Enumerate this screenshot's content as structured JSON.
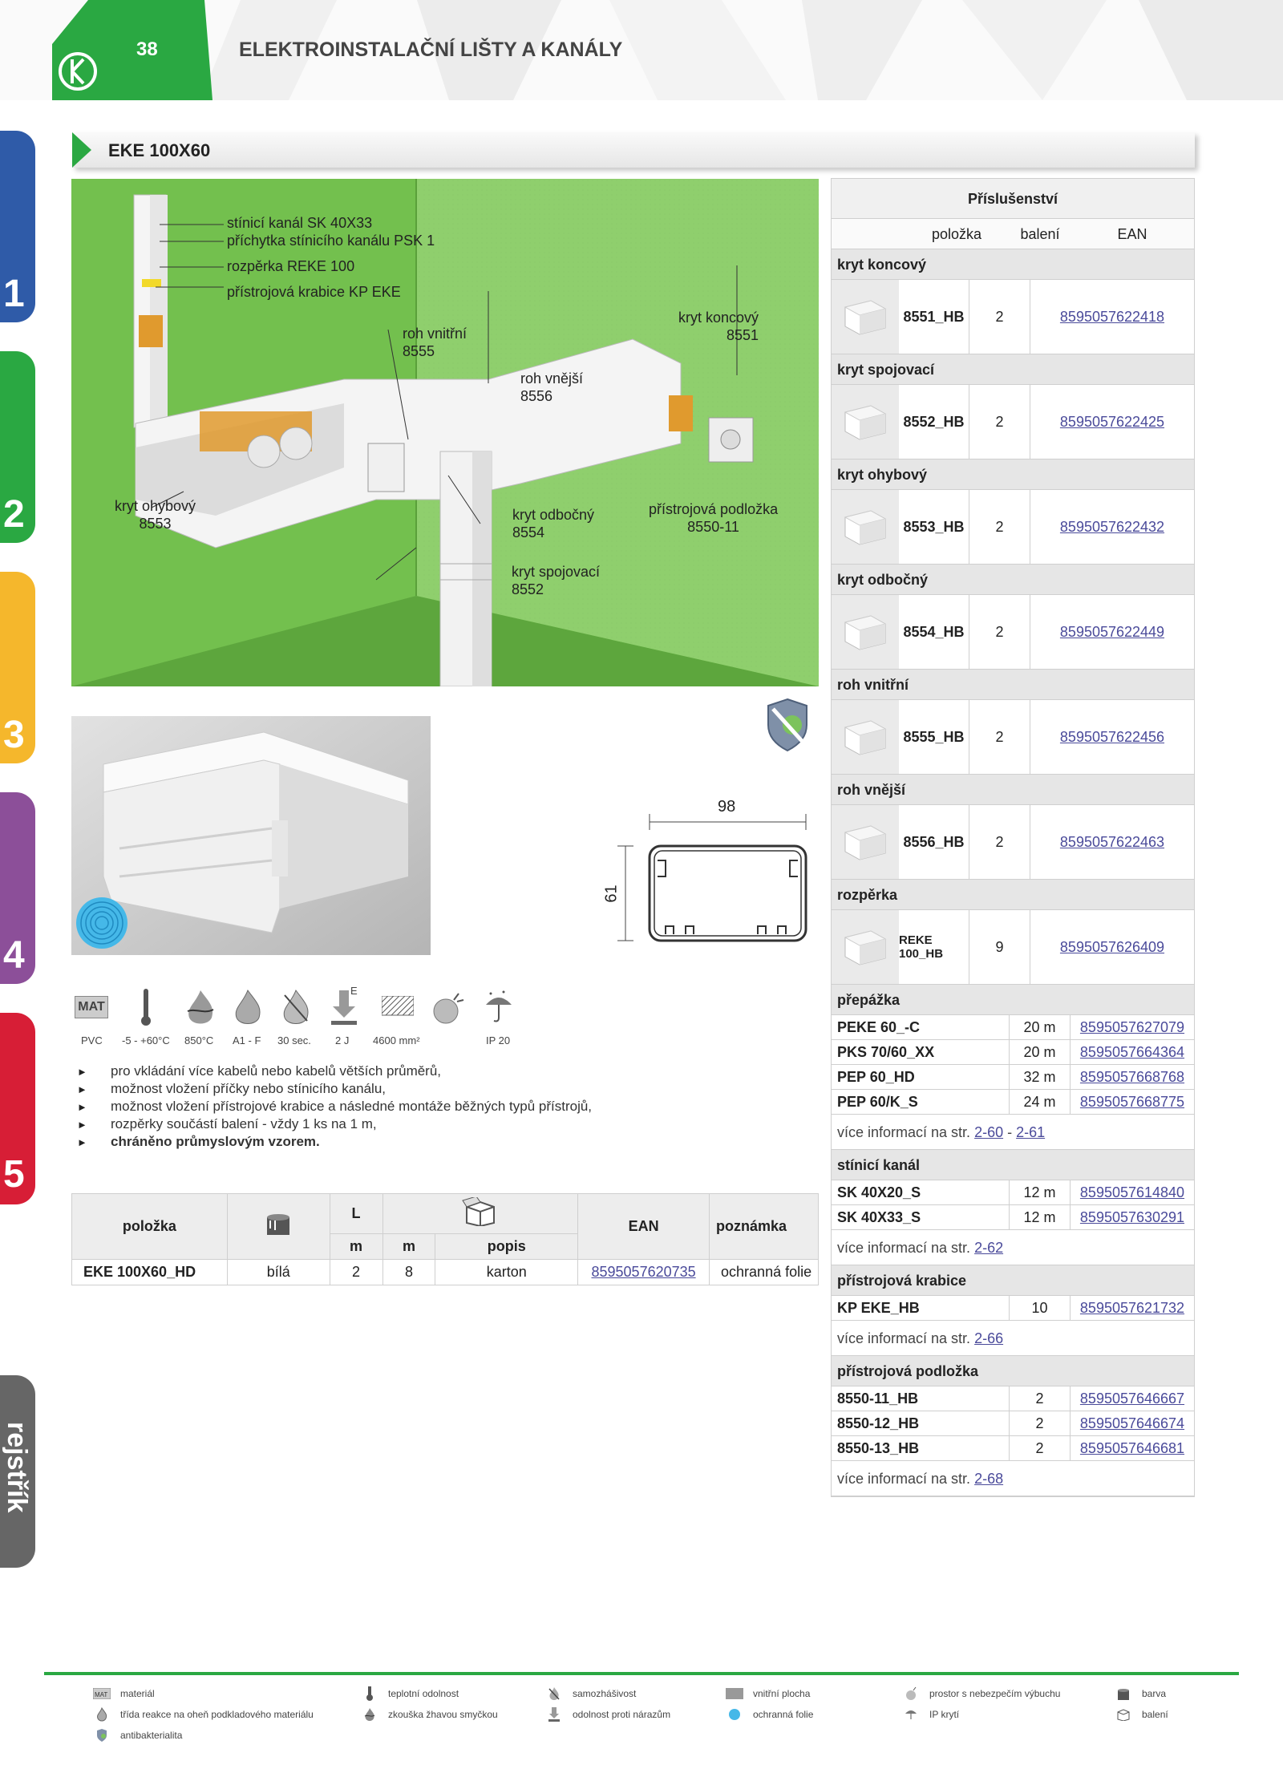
{
  "header": {
    "page_number": "38",
    "title": "ELEKTROINSTALAČNÍ LIŠTY A KANÁLY"
  },
  "colors": {
    "green": "#2aa842",
    "tab1": "#2f5ba8",
    "tab2": "#2aa842",
    "tab3": "#f5b72c",
    "tab4": "#8c4f99",
    "tab5": "#d71e36",
    "index": "#666666",
    "ean_link": "#4a4a9a"
  },
  "tabs": [
    "1",
    "2",
    "3",
    "4",
    "5",
    "rejstřík"
  ],
  "product": {
    "title": "EKE 100X60"
  },
  "scene_callouts": [
    "stínicí kanál SK 40X33",
    "příchytka stínicího kanálu PSK 1",
    "rozpěrka REKE 100",
    "přístrojová krabice KP EKE",
    "roh vnitřní\n8555",
    "roh vnější\n8556",
    "kryt koncový\n8551",
    "kryt ohybový\n8553",
    "kryt odbočný\n8554",
    "přístrojová podložka\n8550-11",
    "kryt spojovací\n8552"
  ],
  "dimensions": {
    "width": "98",
    "height": "61"
  },
  "pictograms": [
    {
      "icon": "mat-icon",
      "label": "PVC"
    },
    {
      "icon": "thermometer-icon",
      "label": "-5 - +60°C"
    },
    {
      "icon": "glow-wire-icon",
      "label": "850°C"
    },
    {
      "icon": "flame-icon",
      "label": "A1 - F"
    },
    {
      "icon": "self-extinguish-icon",
      "label": "30 sec."
    },
    {
      "icon": "impact-icon",
      "label": "2 J"
    },
    {
      "icon": "inner-area-icon",
      "label": "4600 mm²"
    },
    {
      "icon": "explosion-icon",
      "label": ""
    },
    {
      "icon": "ip-umbrella-icon",
      "label": "IP 20"
    }
  ],
  "impact_mark": "E",
  "features": [
    "pro vkládání více kabelů nebo kabelů větších průměrů,",
    "možnost vložení příčky nebo stínicího kanálu,",
    "možnost vložení přístrojové krabice a následné montáže běžných typů přístrojů,",
    "rozpěrky součástí balení - vždy 1 ks na 1 m,",
    "chráněno průmyslovým vzorem."
  ],
  "product_table": {
    "headers": {
      "item": "položka",
      "L": "L",
      "ean": "EAN",
      "note": "poznámka",
      "L_unit": "m",
      "pack_unit": "m",
      "pack_desc": "popis"
    },
    "rows": [
      {
        "item": "EKE 100X60_HD",
        "color": "bílá",
        "length": "2",
        "pack": "8",
        "desc": "karton",
        "ean": "8595057620735",
        "note": "ochranná folie"
      }
    ]
  },
  "accessories": {
    "title": "Příslušenství",
    "columns": [
      "položka",
      "balení",
      "EAN"
    ],
    "image_groups": [
      {
        "name": "kryt koncový",
        "code": "8551_HB",
        "pack": "2",
        "ean": "8595057622418"
      },
      {
        "name": "kryt spojovací",
        "code": "8552_HB",
        "pack": "2",
        "ean": "8595057622425"
      },
      {
        "name": "kryt ohybový",
        "code": "8553_HB",
        "pack": "2",
        "ean": "8595057622432"
      },
      {
        "name": "kryt odbočný",
        "code": "8554_HB",
        "pack": "2",
        "ean": "8595057622449"
      },
      {
        "name": "roh vnitřní",
        "code": "8555_HB",
        "pack": "2",
        "ean": "8595057622456"
      },
      {
        "name": "roh vnější",
        "code": "8556_HB",
        "pack": "2",
        "ean": "8595057622463"
      },
      {
        "name": "rozpěrka",
        "code": "REKE 100_HB",
        "pack": "9",
        "ean": "8595057626409"
      }
    ],
    "list_groups": [
      {
        "name": "přepážka",
        "rows": [
          {
            "code": "PEKE 60_-C",
            "pack": "20 m",
            "ean": "8595057627079"
          },
          {
            "code": "PKS 70/60_XX",
            "pack": "20 m",
            "ean": "8595057664364"
          },
          {
            "code": "PEP 60_HD",
            "pack": "32 m",
            "ean": "8595057668768"
          },
          {
            "code": "PEP 60/K_S",
            "pack": "24 m",
            "ean": "8595057668775"
          }
        ],
        "more_text": "více informací na str.",
        "more_links": [
          "2-60",
          "2-61"
        ],
        "more_sep": "-"
      },
      {
        "name": "stínicí kanál",
        "rows": [
          {
            "code": "SK 40X20_S",
            "pack": "12 m",
            "ean": "8595057614840"
          },
          {
            "code": "SK 40X33_S",
            "pack": "12 m",
            "ean": "8595057630291"
          }
        ],
        "more_text": "více informací na str.",
        "more_links": [
          "2-62"
        ]
      },
      {
        "name": "přístrojová krabice",
        "rows": [
          {
            "code": "KP EKE_HB",
            "pack": "10",
            "ean": "8595057621732"
          }
        ],
        "more_text": "více informací na str.",
        "more_links": [
          "2-66"
        ]
      },
      {
        "name": "přístrojová podložka",
        "rows": [
          {
            "code": "8550-11_HB",
            "pack": "2",
            "ean": "8595057646667"
          },
          {
            "code": "8550-12_HB",
            "pack": "2",
            "ean": "8595057646674"
          },
          {
            "code": "8550-13_HB",
            "pack": "2",
            "ean": "8595057646681"
          }
        ],
        "more_text": "více informací na str.",
        "more_links": [
          "2-68"
        ]
      }
    ]
  },
  "legend": [
    {
      "icon": "mat-icon",
      "label": "materiál"
    },
    {
      "icon": "thermometer-icon",
      "label": "teplotní odolnost"
    },
    {
      "icon": "self-extinguish-icon",
      "label": "samozhášivost"
    },
    {
      "icon": "inner-area-icon",
      "label": "vnitřní plocha"
    },
    {
      "icon": "explosion-icon",
      "label": "prostor s nebezpečím výbuchu"
    },
    {
      "icon": "color-icon",
      "label": "barva"
    },
    {
      "icon": "flame-icon",
      "label": "třída reakce na oheň podkladového materiálu"
    },
    {
      "icon": "glow-wire-icon",
      "label": "zkouška žhavou smyčkou"
    },
    {
      "icon": "impact-icon",
      "label": "odolnost proti nárazům"
    },
    {
      "icon": "foil-icon",
      "label": "ochranná folie"
    },
    {
      "icon": "ip-umbrella-icon",
      "label": "IP krytí"
    },
    {
      "icon": "package-icon",
      "label": "balení"
    },
    {
      "icon": "antibacterial-icon",
      "label": "antibakterialita"
    }
  ],
  "mat_text": "MAT"
}
